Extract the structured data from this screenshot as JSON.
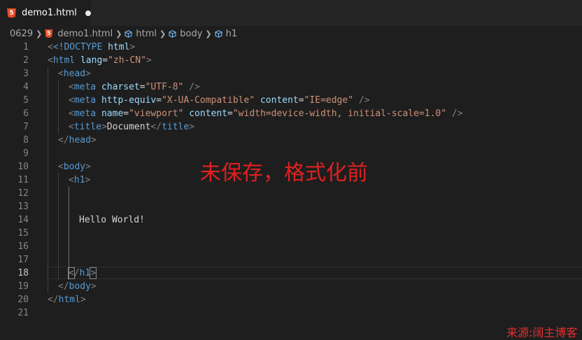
{
  "tab": {
    "title": "demo1.html",
    "icon": "html5-icon",
    "dirty": true
  },
  "breadcrumb": {
    "folder": "0629",
    "file": "demo1.html",
    "symbols": [
      "html",
      "body",
      "h1"
    ]
  },
  "editor": {
    "active_line": 18,
    "lines": [
      {
        "n": "1"
      },
      {
        "n": "2"
      },
      {
        "n": "3"
      },
      {
        "n": "4"
      },
      {
        "n": "5"
      },
      {
        "n": "6"
      },
      {
        "n": "7"
      },
      {
        "n": "8"
      },
      {
        "n": "9"
      },
      {
        "n": "10"
      },
      {
        "n": "11"
      },
      {
        "n": "12"
      },
      {
        "n": "13"
      },
      {
        "n": "14"
      },
      {
        "n": "15"
      },
      {
        "n": "16"
      },
      {
        "n": "17"
      },
      {
        "n": "18"
      },
      {
        "n": "19"
      },
      {
        "n": "20"
      },
      {
        "n": "21"
      }
    ],
    "code": {
      "doctype": "<!DOCTYPE",
      "doctype_kw": "html",
      "html_tag": "html",
      "lang_attr": "lang",
      "lang_val": "\"zh-CN\"",
      "head_tag": "head",
      "meta_tag": "meta",
      "charset_attr": "charset",
      "charset_val": "\"UTF-8\"",
      "http_equiv_attr": "http-equiv",
      "http_equiv_val": "\"X-UA-Compatible\"",
      "content_attr": "content",
      "content_val_1": "\"IE=edge\"",
      "name_attr": "name",
      "name_val": "\"viewport\"",
      "content_val_2": "\"width=device-width, initial-scale=1.0\"",
      "title_tag": "title",
      "title_text": "Document",
      "body_tag": "body",
      "h1_tag": "h1",
      "h1_text": "Hello World!"
    }
  },
  "annotation": "未保存，格式化前",
  "watermark": "来源:阔主博客"
}
